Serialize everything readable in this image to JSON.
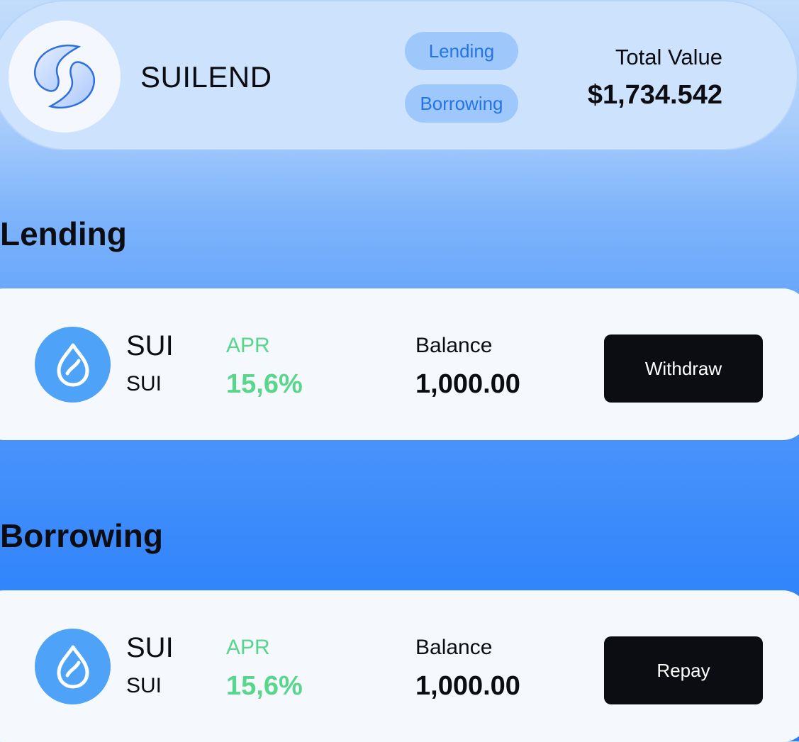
{
  "header": {
    "brand_name": "SUILEND",
    "nav": {
      "lending_label": "Lending",
      "borrowing_label": "Borrowing"
    },
    "total_value_label": "Total Value",
    "total_value": "$1,734.542",
    "logo_icon": "suilend-logo"
  },
  "lending": {
    "title": "Lending",
    "positions": [
      {
        "symbol": "SUI",
        "name": "SUI",
        "icon": "sui-droplet-icon",
        "apr_label": "APR",
        "apr_value": "15,6%",
        "balance_label": "Balance",
        "balance_value": "1,000.00",
        "action_label": "Withdraw"
      }
    ]
  },
  "borrowing": {
    "title": "Borrowing",
    "positions": [
      {
        "symbol": "SUI",
        "name": "SUI",
        "icon": "sui-droplet-icon",
        "apr_label": "APR",
        "apr_value": "15,6%",
        "balance_label": "Balance",
        "balance_value": "1,000.00",
        "action_label": "Repay"
      }
    ]
  },
  "colors": {
    "accent_blue": "#2474e8",
    "apr_green": "#58d68c",
    "button_dark": "#0c0d12",
    "token_blue": "#4ea2f8"
  }
}
